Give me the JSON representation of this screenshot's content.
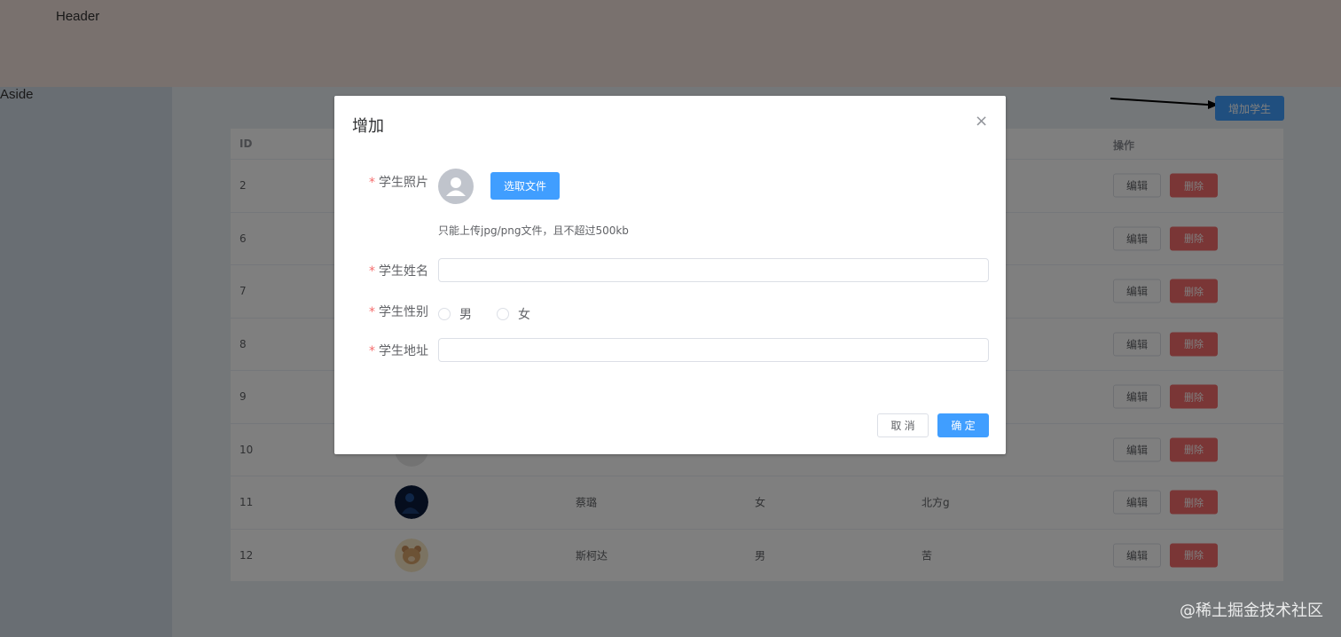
{
  "header": {
    "title": "Header"
  },
  "aside": {
    "title": "Aside"
  },
  "toolbar": {
    "add_label": "增加学生"
  },
  "table": {
    "headers": {
      "id": "ID",
      "actions": "操作"
    },
    "rows": [
      {
        "id": "2",
        "name": "",
        "gender": "",
        "address": ""
      },
      {
        "id": "6",
        "name": "",
        "gender": "",
        "address": ""
      },
      {
        "id": "7",
        "name": "",
        "gender": "",
        "address": ""
      },
      {
        "id": "8",
        "name": "",
        "gender": "",
        "address": ""
      },
      {
        "id": "9",
        "name": "",
        "gender": "",
        "address": ""
      },
      {
        "id": "10",
        "name": "",
        "gender": "",
        "address": ""
      },
      {
        "id": "11",
        "name": "蔡璐",
        "gender": "女",
        "address": "北方g"
      },
      {
        "id": "12",
        "name": "斯柯达",
        "gender": "男",
        "address": "苦"
      }
    ],
    "edit_label": "编辑",
    "delete_label": "删除"
  },
  "dialog": {
    "title": "增加",
    "close_icon": "×",
    "photo_label": "学生照片",
    "pick_file_label": "选取文件",
    "upload_tip": "只能上传jpg/png文件，且不超过500kb",
    "name_label": "学生姓名",
    "name_value": "",
    "gender_label": "学生性别",
    "gender_options": [
      "男",
      "女"
    ],
    "address_label": "学生地址",
    "address_value": "",
    "required_mark": "*",
    "cancel_label": "取 消",
    "ok_label": "确 定"
  },
  "watermark": "@稀土掘金技术社区",
  "colors": {
    "primary": "#409eff",
    "danger": "#f56c6c",
    "header_bg": "#f3e2dd",
    "aside_bg": "#d3dce6",
    "main_bg": "#e9eef3"
  }
}
